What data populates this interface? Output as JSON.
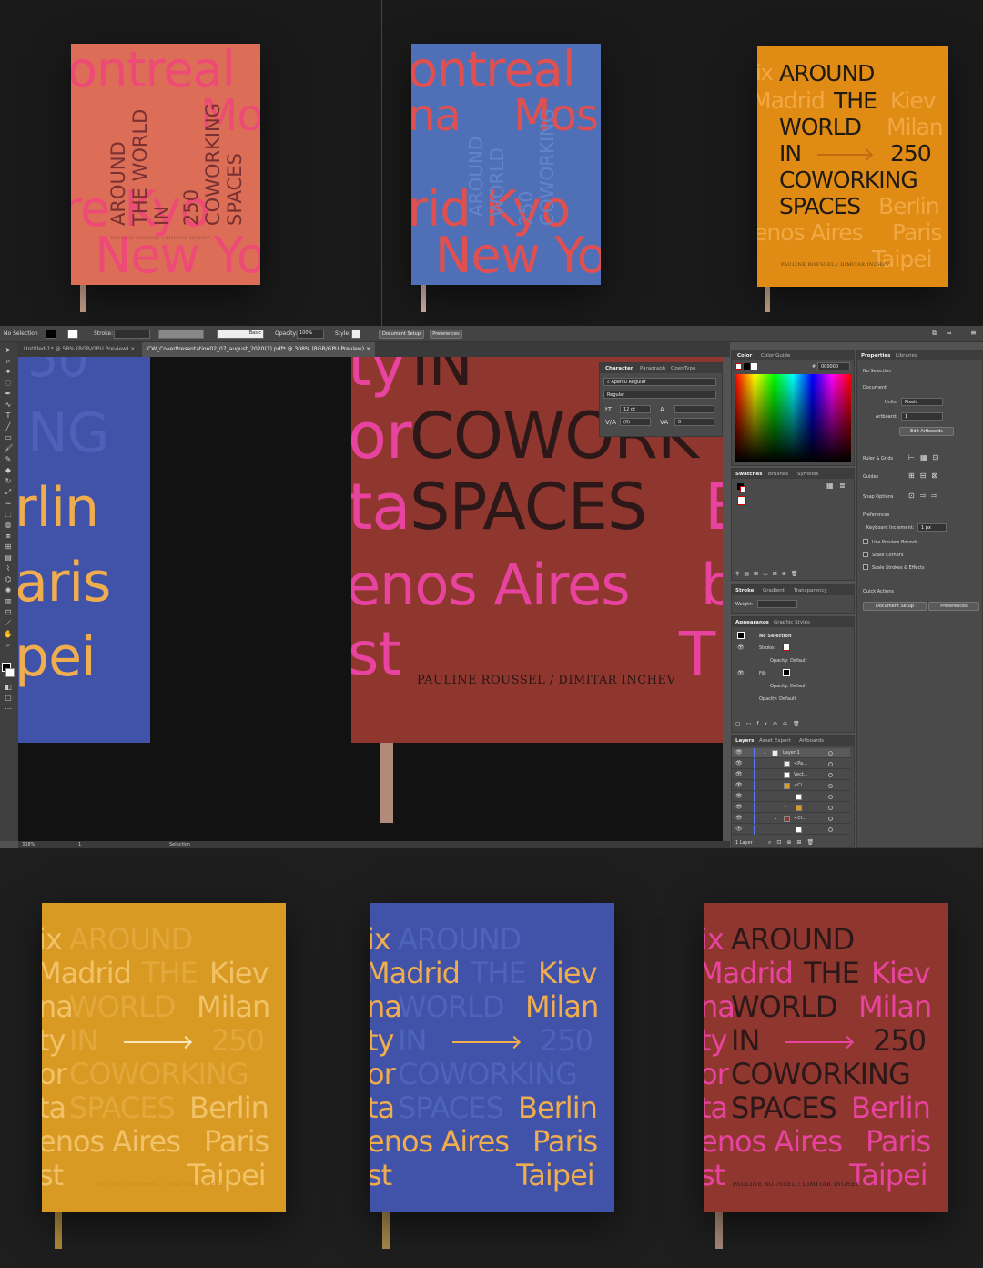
{
  "colors": {
    "salmon": "#dc6e58",
    "salmon_text": "#ee4a76",
    "blue": "#4f6fb7",
    "blue_text": "#e05050",
    "orange": "#e08b13",
    "mustard": "#d89a23",
    "mustard_text": "#f1c268",
    "royal": "#4053a9",
    "royal_text": "#f0ad4e",
    "brick": "#8f372f",
    "brick_text": "#e8439e",
    "dark_text": "#2c1818"
  },
  "book": {
    "title_lines": [
      "AROUND",
      "THE",
      "WORLD",
      "IN",
      "COWORKING",
      "SPACES"
    ],
    "count": "250",
    "author": "PAULINE ROUSSEL / DIMITAR INCHEV",
    "cities": {
      "montreal": "ontreal",
      "moscow": "Mos",
      "na": "na",
      "madrid_partial": "rid Kyo",
      "newyork": "New Yo",
      "re": "re Kyo",
      "ix": "ix",
      "madrid": "Madrid",
      "kiev": "Kiev",
      "milan": "Milan",
      "na2": "na",
      "ty": "ty",
      "or": "or",
      "ta": "ta",
      "berlin": "Berlin",
      "buenos": "enos Aires",
      "paris": "Paris",
      "st": "st",
      "taipei": "Taipei"
    }
  },
  "illustrator": {
    "control_bar": {
      "selection": "No Selection",
      "stroke": "Stroke:",
      "basic": "Basic",
      "opacity_label": "Opacity:",
      "opacity_value": "100%",
      "style_label": "Style:",
      "doc_setup": "Document Setup",
      "preferences": "Preferences"
    },
    "tabs": [
      "Untitled-1* @ 58% (RGB/GPU Preview)",
      "CW_CoverPresentation02_07_august_2020(1).pdf* @ 308% (RGB/GPU Preview)"
    ],
    "canvas": {
      "left_book": {
        "top": "50",
        "ng": "NG",
        "berlin": "rlin",
        "paris": "aris",
        "taipei": "pei"
      },
      "main_book": {
        "line1_left": "ty",
        "line1_right": "IN",
        "line2_left": "or",
        "line2_right": "COWORK",
        "line3_left": "ta",
        "line3_mid": "SPACES",
        "line3_right": "B",
        "line4": "enos Aires",
        "line4_right": "b",
        "line5_left": "st",
        "line5_right": "T",
        "author": "PAULINE ROUSSEL / DIMITAR INCHEV"
      }
    },
    "character_panel": {
      "tabs": [
        "Character",
        "Paragraph",
        "OpenType"
      ],
      "font": "Apercu Regular",
      "style": "Regular",
      "size": "12 pt",
      "tracking": "(0)",
      "kerning": "0"
    },
    "color_panel": {
      "tabs": [
        "Color",
        "Color Guide"
      ],
      "hex_label": "#",
      "hex": "000000"
    },
    "swatches_tabs": [
      "Swatches",
      "Brushes",
      "Symbols"
    ],
    "stroke_tabs": [
      "Stroke",
      "Gradient",
      "Transparency"
    ],
    "weight_label": "Weight:",
    "appearance": {
      "tabs": [
        "Appearance",
        "Graphic Styles"
      ],
      "title": "No Selection",
      "rows": [
        "Stroke:",
        "Opacity: Default",
        "Fill:",
        "Opacity: Default",
        "Opacity: Default"
      ]
    },
    "layers": {
      "tabs": [
        "Layers",
        "Asset Export",
        "Artboards"
      ],
      "rows": [
        "Layer 1",
        "<Pa...",
        "Vect...",
        "<Cl...",
        "",
        "",
        "<Cl...",
        ""
      ],
      "footer": "1 Layer"
    },
    "properties": {
      "tabs": [
        "Properties",
        "Libraries"
      ],
      "selection": "No Selection",
      "document": "Document",
      "units_label": "Units:",
      "units": "Pixels",
      "artboard_label": "Artboard:",
      "artboard": "1",
      "edit_artboards": "Edit Artboards",
      "ruler_grids": "Ruler & Grids",
      "guides": "Guides",
      "snap_options": "Snap Options",
      "preferences": "Preferences",
      "keyboard_increment_label": "Keyboard Increment:",
      "keyboard_increment": "1 px",
      "checks": [
        "Use Preview Bounds",
        "Scale Corners",
        "Scale Strokes & Effects"
      ],
      "quick_actions": "Quick Actions",
      "doc_setup": "Document Setup",
      "prefs_btn": "Preferences"
    },
    "status": {
      "zoom": "308%",
      "page": "1",
      "tool": "Selection"
    }
  }
}
